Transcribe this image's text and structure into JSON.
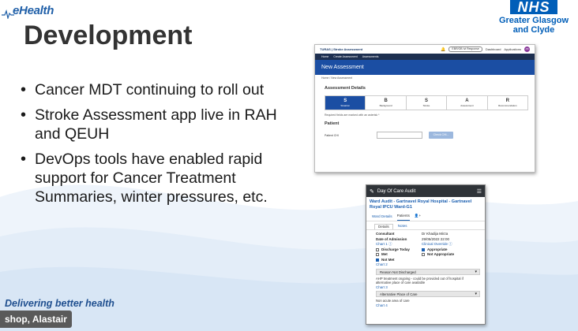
{
  "logo": {
    "text": "eHealth"
  },
  "nhs": {
    "badge": "NHS",
    "line1": "Greater Glasgow",
    "line2": "and Clyde"
  },
  "title": "Development",
  "bullets": [
    "Cancer MDT continuing to roll out",
    "Stroke Assessment app live in RAH and QEUH",
    "DevOps tools have enabled rapid support for Cancer Treatment Summaries, winter pressures, etc."
  ],
  "footer": {
    "tagline": "Delivering better health",
    "presenter": "shop, Alastair"
  },
  "stroke_app": {
    "brand": "TURAS | Stroke Assessment",
    "pill": "EBR/OB Ivl Response",
    "dashboard": "Dashboard",
    "applications": "Applications",
    "avatar": "AB",
    "nav": [
      "Home",
      "Create Assessment",
      "Assessments"
    ],
    "banner": "New Assessment",
    "breadcrumb": "Home  /  New Assessment",
    "section_title": "Assessment Details",
    "steps": [
      {
        "key": "S",
        "label": "Situation"
      },
      {
        "key": "B",
        "label": "Background"
      },
      {
        "key": "S",
        "label": "Stroke"
      },
      {
        "key": "A",
        "label": "Assessment"
      },
      {
        "key": "R",
        "label": "Recommendation"
      }
    ],
    "required_note": "Required fields are marked with an asterisk *",
    "patient_title": "Patient",
    "patient_chi_label": "Patient CHI",
    "check_button": "Check CHI..."
  },
  "audit_app": {
    "header": "Day Of Care Audit",
    "ward": "Ward Audit - Gartnavel Royal Hospital - Gartnavel Royal IPCU Ward-G1",
    "tabs": [
      "Ward Details",
      "Patients"
    ],
    "subtabs": [
      "Details",
      "Notes"
    ],
    "consultant_label": "Consultant",
    "consultant_value": "Dr Khadija Mirza",
    "admission_label": "Date of Admission",
    "admission_value": "29/05/2022 22:00",
    "chart1": "Chart 1",
    "clinical_override": "Clinical Override",
    "opt_discharge": "Discharge Today",
    "opt_met": "Met",
    "opt_not_met": "Not Met",
    "opt_appropriate": "Appropriate",
    "opt_not_appropriate": "Not Appropriate",
    "chart2": "Chart 2",
    "select1": "Reason Not Discharged",
    "note1": "AHP treatment ongoing - could be provided out of hospital if alternative place of care available",
    "chart3": "Chart 3",
    "select2": "Alternative Place of Care",
    "note2": "Non acute area of care",
    "chart4": "Chart 4"
  },
  "colors": {
    "nhs_blue": "#005eb8",
    "banner_blue": "#1b4ea3",
    "nav_dark": "#1d2f50"
  }
}
